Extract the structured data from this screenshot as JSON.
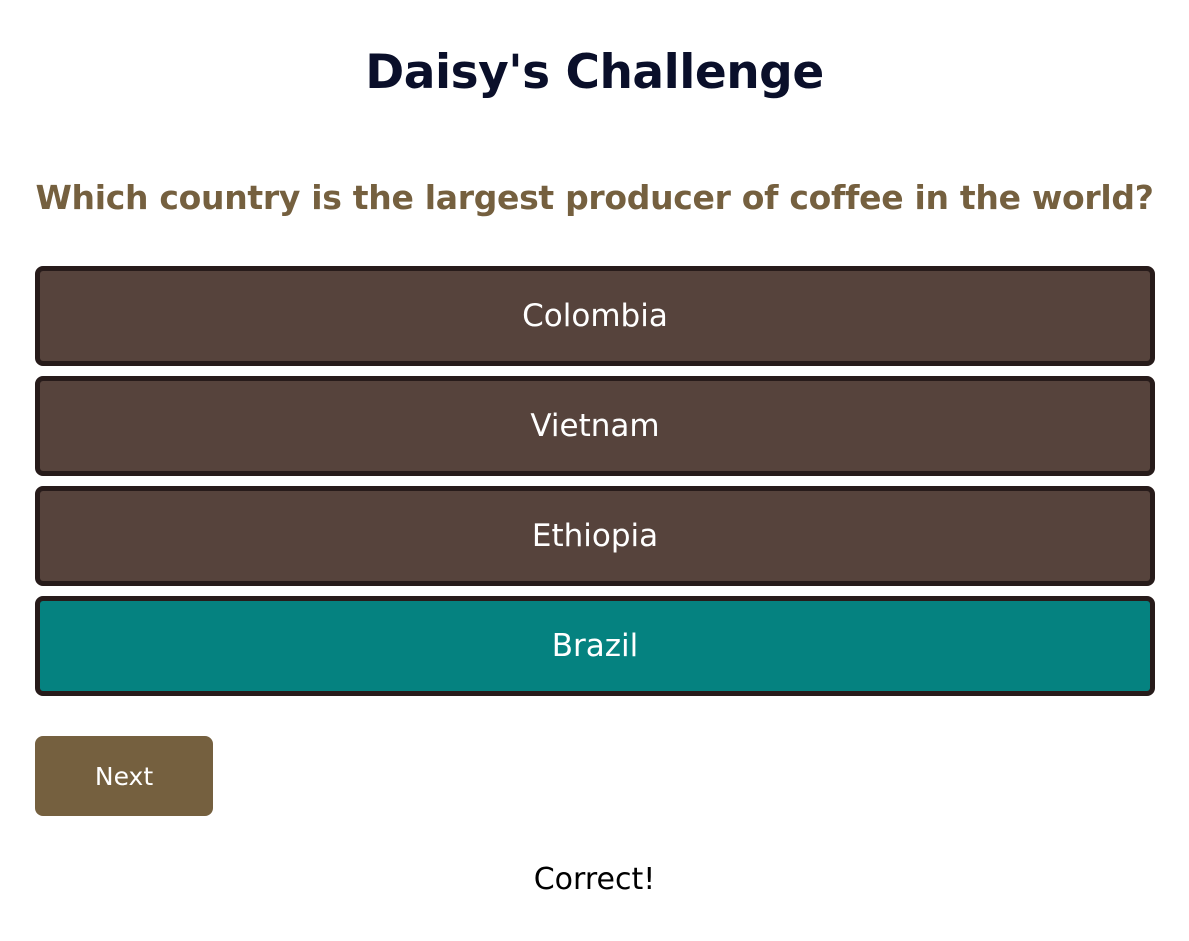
{
  "quiz": {
    "title": "Daisy's Challenge",
    "question": "Which country is the largest producer of coffee in the world?",
    "answers": [
      {
        "label": "Colombia",
        "state": "default"
      },
      {
        "label": "Vietnam",
        "state": "default"
      },
      {
        "label": "Ethiopia",
        "state": "default"
      },
      {
        "label": "Brazil",
        "state": "correct"
      }
    ],
    "next_label": "Next",
    "feedback": "Correct!"
  },
  "colors": {
    "title": "#0a0f2a",
    "question": "#75603f",
    "answer_bg": "#56433c",
    "answer_border": "#271b1a",
    "correct_bg": "#058280",
    "next_bg": "#75603f",
    "feedback": "#000000"
  }
}
